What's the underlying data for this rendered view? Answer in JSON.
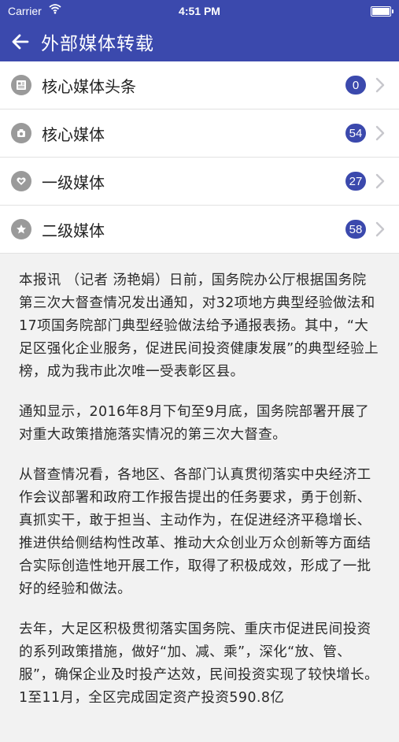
{
  "status": {
    "carrier": "Carrier",
    "time": "4:51 PM"
  },
  "nav": {
    "title": "外部媒体转载"
  },
  "menu": [
    {
      "label": "核心媒体头条",
      "count": "0",
      "icon": "newspaper-icon"
    },
    {
      "label": "核心媒体",
      "count": "54",
      "icon": "media-camera-icon"
    },
    {
      "label": "一级媒体",
      "count": "27",
      "icon": "heart-icon"
    },
    {
      "label": "二级媒体",
      "count": "58",
      "icon": "star-icon"
    }
  ],
  "article": {
    "paragraphs": [
      "本报讯 （记者 汤艳娟）日前，国务院办公厅根据国务院第三次大督查情况发出通知，对32项地方典型经验做法和17项国务院部门典型经验做法给予通报表扬。其中，“大足区强化企业服务，促进民间投资健康发展”的典型经验上榜，成为我市此次唯一受表彰区县。",
      "通知显示，2016年8月下旬至9月底，国务院部署开展了对重大政策措施落实情况的第三次大督查。",
      "从督查情况看，各地区、各部门认真贯彻落实中央经济工作会议部署和政府工作报告提出的任务要求，勇于创新、真抓实干，敢于担当、主动作为，在促进经济平稳增长、推进供给侧结构性改革、推动大众创业万众创新等方面结合实际创造性地开展工作，取得了积极成效，形成了一批好的经验和做法。",
      "去年，大足区积极贯彻落实国务院、重庆市促进民间投资的系列政策措施，做好“加、减、乘”，深化“放、管、服”，确保企业及时投产达效，民间投资实现了较快增长。1至11月，全区完成固定资产投资590.8亿"
    ]
  },
  "colors": {
    "accent": "#3b49ad",
    "icon_gray": "#9a9a9a",
    "article_bg": "#f2f2f2"
  }
}
